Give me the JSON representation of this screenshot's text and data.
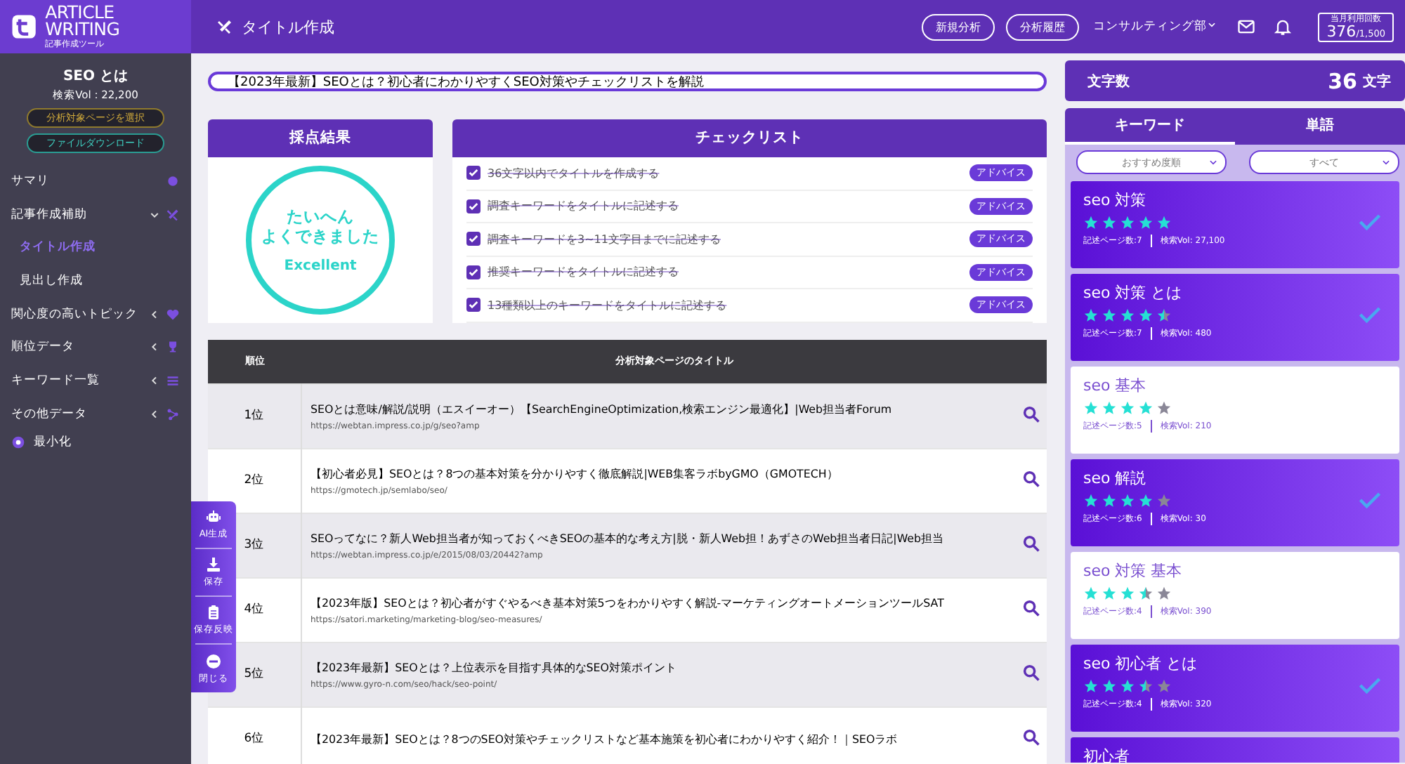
{
  "sidebar": {
    "logo": {
      "title": "ARTICLE WRITING",
      "subtitle": "記事作成ツール"
    },
    "keyword": "SEO とは",
    "volume": "検索Vol : 22,200",
    "buttons": [
      {
        "label": "分析対象ページを選択",
        "kind": "gold"
      },
      {
        "label": "ファイルダウンロード",
        "kind": "teal"
      }
    ],
    "items": [
      {
        "label": "サマリ"
      },
      {
        "label": "記事作成補助",
        "expanded": true,
        "children": [
          {
            "label": "タイトル作成",
            "selected": true
          },
          {
            "label": "見出し作成",
            "selected": false
          }
        ]
      },
      {
        "label": "関心度の高いトピック",
        "expanded": false
      },
      {
        "label": "順位データ",
        "expanded": false
      },
      {
        "label": "キーワード一覧",
        "expanded": false
      },
      {
        "label": "その他データ",
        "expanded": false
      }
    ],
    "minimize": "最小化"
  },
  "header": {
    "title": "タイトル作成",
    "buttons": [
      "新規分析",
      "分析履歴"
    ],
    "department": "コンサルティング部",
    "usage": {
      "label": "当月利用回数",
      "count": "376",
      "limit": "/1,500"
    }
  },
  "title_input": {
    "value": "【2023年最新】SEOとは？初心者にわかりやすくSEO対策やチェックリストを解説"
  },
  "score": {
    "heading": "採点結果",
    "stamp": [
      "たいへん",
      "よくできました"
    ],
    "grade": "Excellent"
  },
  "checklist": {
    "heading": "チェックリスト",
    "items": [
      {
        "label": "36文字以内でタイトルを作成する",
        "checked": true,
        "advice": "アドバイス"
      },
      {
        "label": "調査キーワードをタイトルに記述する",
        "checked": true,
        "advice": "アドバイス"
      },
      {
        "label": "調査キーワードを3~11文字目までに記述する",
        "checked": true,
        "advice": "アドバイス"
      },
      {
        "label": "推奨キーワードをタイトルに記述する",
        "checked": true,
        "advice": "アドバイス"
      },
      {
        "label": "13種類以上のキーワードをタイトルに記述する",
        "checked": true,
        "advice": "アドバイス"
      }
    ]
  },
  "table": {
    "columns": [
      "順位",
      "分析対象ページのタイトル"
    ],
    "rows": [
      {
        "rank": "1位",
        "title": "SEOとは意味/解説/説明（エスイーオー）【SearchEngineOptimization,検索エンジン最適化】|Web担当者Forum",
        "url": "https://webtan.impress.co.jp/g/seo?amp"
      },
      {
        "rank": "2位",
        "title": "【初心者必見】SEOとは？8つの基本対策を分かりやすく徹底解説|WEB集客ラボbyGMO（GMOTECH）",
        "url": "https://gmotech.jp/semlabo/seo/"
      },
      {
        "rank": "3位",
        "title": "SEOってなに？新人Web担当者が知っておくべきSEOの基本的な考え方|脱・新人Web担！あずさのWeb担当者日記|Web担当",
        "url": "https://webtan.impress.co.jp/e/2015/08/03/20442?amp"
      },
      {
        "rank": "4位",
        "title": "【2023年版】SEOとは？初心者がすぐやるべき基本対策5つをわかりやすく解説-マーケティングオートメーションツールSAT",
        "url": "https://satori.marketing/marketing-blog/seo-measures/"
      },
      {
        "rank": "5位",
        "title": "【2023年最新】SEOとは？上位表示を目指す具体的なSEO対策ポイント",
        "url": "https://www.gyro-n.com/seo/hack/seo-point/"
      },
      {
        "rank": "6位",
        "title": "【2023年最新】SEOとは？8つのSEO対策やチェックリストなど基本施策を初心者にわかりやすく紹介！｜SEOラボ"
      }
    ]
  },
  "dock": [
    {
      "label": "AI生成"
    },
    {
      "label": "保存"
    },
    {
      "label": "保存反映"
    },
    {
      "label": "閉じる"
    }
  ],
  "right": {
    "count_label": "文字数",
    "count": "36",
    "count_unit": "文字",
    "tabs": [
      {
        "label": "キーワード",
        "selected": true
      },
      {
        "label": "単語",
        "selected": false
      }
    ],
    "filters": [
      "おすすめ度順",
      "すべて"
    ],
    "keywords": [
      {
        "title": "seo 対策",
        "stars": 5,
        "pages": "記述ページ数:7",
        "volume": "検索Vol: 27,100",
        "selected": true
      },
      {
        "title": "seo 対策 とは",
        "stars": 4.5,
        "pages": "記述ページ数:7",
        "volume": "検索Vol: 480",
        "selected": true
      },
      {
        "title": "seo 基本",
        "stars": 4,
        "pages": "記述ページ数:5",
        "volume": "検索Vol: 210",
        "selected": false
      },
      {
        "title": "seo 解説",
        "stars": 4,
        "pages": "記述ページ数:6",
        "volume": "検索Vol: 30",
        "selected": true
      },
      {
        "title": "seo 対策 基本",
        "stars": 3.5,
        "pages": "記述ページ数:4",
        "volume": "検索Vol: 390",
        "selected": false
      },
      {
        "title": "seo 初心者 とは",
        "stars": 3.5,
        "pages": "記述ページ数:4",
        "volume": "検索Vol: 320",
        "selected": true
      },
      {
        "title": "初心者",
        "selected": true
      }
    ]
  }
}
